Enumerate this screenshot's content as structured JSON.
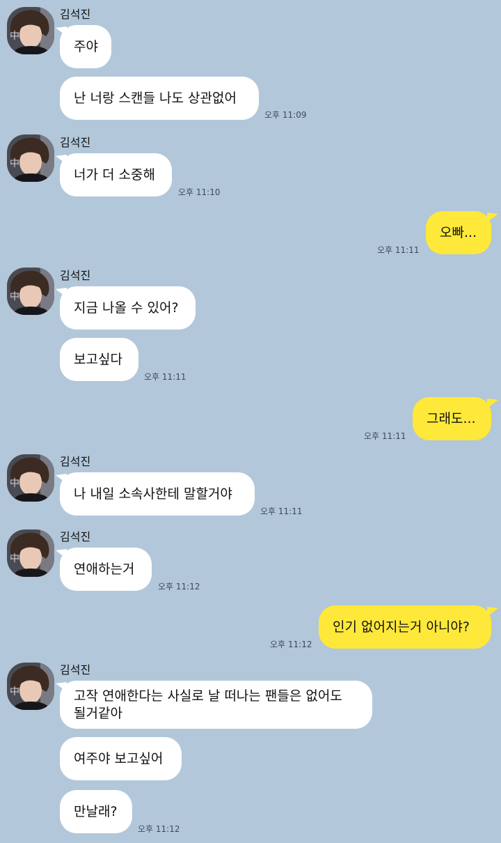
{
  "sender": {
    "name": "김석진",
    "avatar": "profile-photo"
  },
  "colors": {
    "background": "#b2c7da",
    "incoming_bubble": "#ffffff",
    "outgoing_bubble": "#fee83a"
  },
  "messages": [
    {
      "direction": "in",
      "text": "주야"
    },
    {
      "direction": "in",
      "text": "난 너랑 스캔들 나도 상관없어",
      "time": "오후 11:09"
    },
    {
      "direction": "in",
      "text": "너가 더 소중해",
      "time": "오후 11:10"
    },
    {
      "direction": "out",
      "text": "오빠...",
      "time": "오후 11:11"
    },
    {
      "direction": "in",
      "text": "지금 나올 수 있어?"
    },
    {
      "direction": "in",
      "text": "보고싶다",
      "time": "오후 11:11"
    },
    {
      "direction": "out",
      "text": "그래도...",
      "time": "오후 11:11"
    },
    {
      "direction": "in",
      "text": "나 내일 소속사한테 말할거야",
      "time": "오후 11:11"
    },
    {
      "direction": "in",
      "text": "연애하는거",
      "time": "오후 11:12"
    },
    {
      "direction": "out",
      "text": "인기 없어지는거 아니야?",
      "time": "오후 11:12"
    },
    {
      "direction": "in",
      "text": "고작 연애한다는 사실로 날 떠나는 팬들은 없어도 될거같아"
    },
    {
      "direction": "in",
      "text": "여주야 보고싶어"
    },
    {
      "direction": "in",
      "text": "만날래?",
      "time": "오후 11:12"
    }
  ]
}
